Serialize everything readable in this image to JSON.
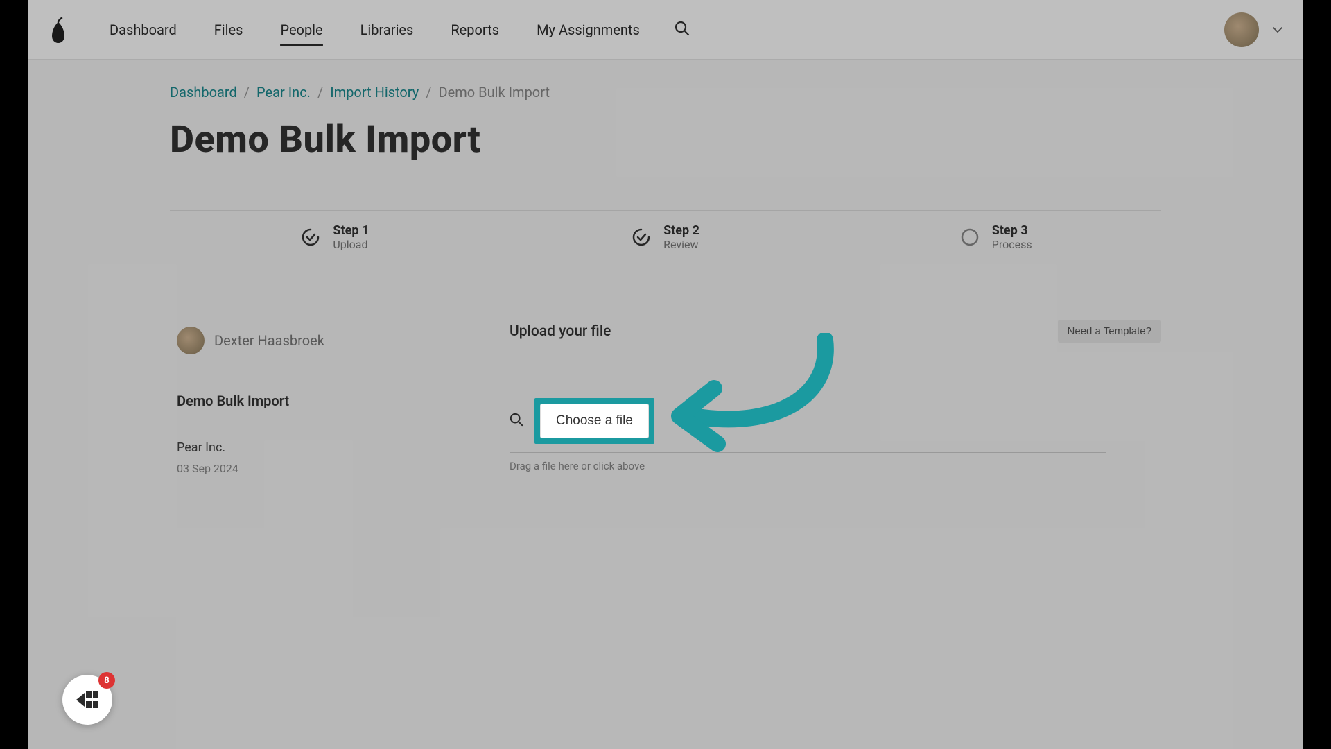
{
  "nav": {
    "items": [
      "Dashboard",
      "Files",
      "People",
      "Libraries",
      "Reports",
      "My Assignments"
    ],
    "active_index": 2
  },
  "breadcrumb": {
    "items": [
      "Dashboard",
      "Pear Inc.",
      "Import History"
    ],
    "current": "Demo Bulk Import"
  },
  "page": {
    "title": "Demo Bulk Import"
  },
  "steps": [
    {
      "title": "Step 1",
      "sub": "Upload",
      "state": "done"
    },
    {
      "title": "Step 2",
      "sub": "Review",
      "state": "done"
    },
    {
      "title": "Step 3",
      "sub": "Process",
      "state": "pending"
    }
  ],
  "left": {
    "user_name": "Dexter Haasbroek",
    "import_name": "Demo Bulk Import",
    "company": "Pear Inc.",
    "date": "03 Sep 2024"
  },
  "upload": {
    "title": "Upload your file",
    "template_btn": "Need a Template?",
    "choose_file": "Choose a file",
    "drag_hint": "Drag a file here or click above"
  },
  "help": {
    "badge_count": "8"
  },
  "colors": {
    "teal": "#1b9aa0",
    "link": "#1b8a8f"
  }
}
